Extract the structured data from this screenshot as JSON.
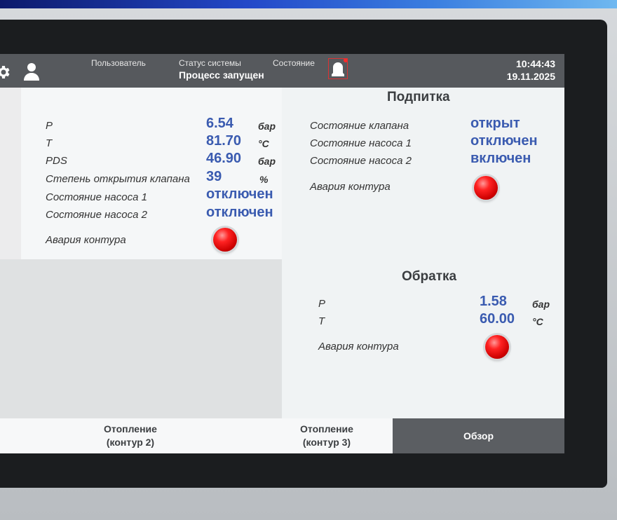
{
  "header": {
    "user_label": "Пользователь",
    "status_label": "Статус системы",
    "status_value": "Процесс запущен",
    "state_label": "Состояние",
    "time": "10:44:43",
    "date": "19.11.2025",
    "icons": [
      "gear-icon",
      "user-icon",
      "bell-icon"
    ]
  },
  "left_panel": {
    "rows": [
      {
        "label": "P",
        "value": "6.54",
        "unit": "бар"
      },
      {
        "label": "T",
        "value": "81.70",
        "unit": "°C"
      },
      {
        "label": "PDS",
        "value": "46.90",
        "unit": "бар"
      },
      {
        "label": "Степень открытия клапана",
        "value": "39",
        "unit": "%"
      },
      {
        "label": "Состояние насоса 1",
        "value": "отключен",
        "unit": ""
      },
      {
        "label": "Состояние насоса 2",
        "value": "отключен",
        "unit": ""
      }
    ],
    "alarm_label": "Авария контура"
  },
  "podpitka": {
    "title": "Подпитка",
    "rows": [
      {
        "label": "Состояние клапана",
        "value": "открыт"
      },
      {
        "label": "Состояние насоса 1",
        "value": "отключен"
      },
      {
        "label": "Состояние насоса 2",
        "value": "включен"
      }
    ],
    "alarm_label": "Авария контура"
  },
  "obratka": {
    "title": "Обратка",
    "rows": [
      {
        "label": "P",
        "value": "1.58",
        "unit": "бар"
      },
      {
        "label": "T",
        "value": "60.00",
        "unit": "°C"
      }
    ],
    "alarm_label": "Авария контура"
  },
  "tabs": [
    {
      "label_line1": "Отопление",
      "label_line2": "(контур 2)"
    },
    {
      "label_line1": "Отопление",
      "label_line2": "(контур 3)"
    },
    {
      "label_line1": "Обзор",
      "label_line2": ""
    }
  ],
  "colors": {
    "value_blue": "#3a5bb0",
    "header_bg": "#56595d",
    "alarm_red": "#e01010",
    "active_tab": "#5b5e62"
  }
}
